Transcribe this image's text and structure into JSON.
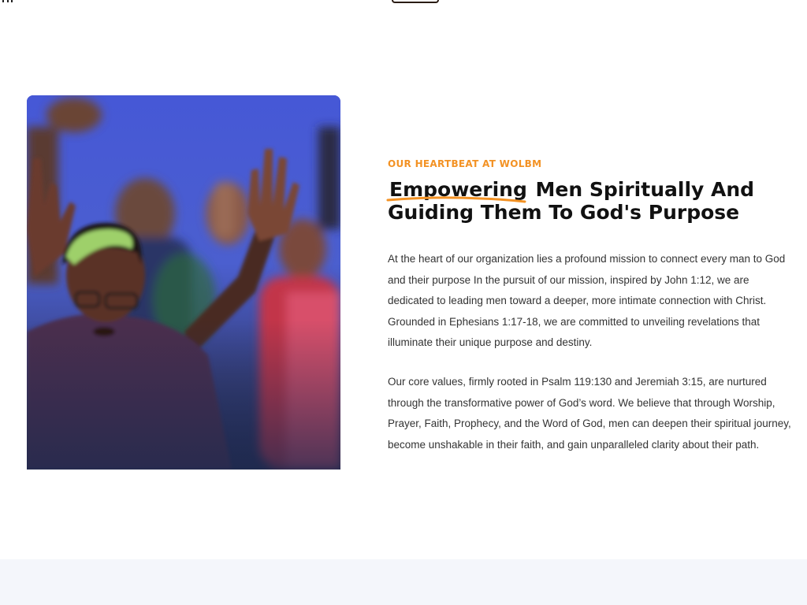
{
  "about": {
    "eyebrow": "OUR HEARTBEAT AT WOLBM",
    "heading_highlight": "Empowering",
    "heading_rest": " Men Spiritually And Guiding Them To God's Purpose",
    "paragraphs": [
      "At the heart of our organization lies a profound mission to connect every man to God and their purpose In the pursuit of our mission, inspired by John 1:12, we are dedicated to leading men toward a deeper, more intimate connection with Christ. Grounded in Ephesians 1:17-18, we are committed to unveiling revelations that illuminate their unique purpose and destiny.",
      "Our core values, firmly rooted in Psalm 119:130 and Jeremiah 3:15, are nurtured through the transformative power of God’s word. We believe that through Worship, Prayer, Faith, Prophecy, and the Word of God, men can deepen their spiritual journey, become unshakable in their faith, and gain unparalleled clarity about their path."
    ]
  },
  "colors": {
    "accent": "#f39224",
    "heading": "#111111",
    "body_text": "#333333",
    "band": "#f4f6fb"
  }
}
